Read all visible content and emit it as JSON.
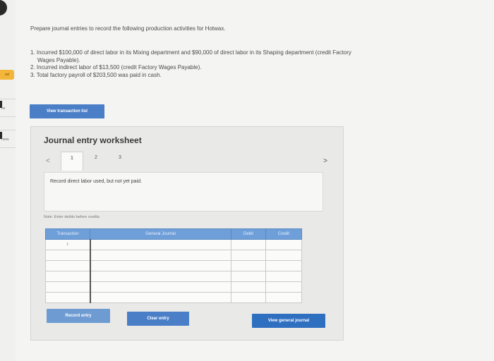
{
  "sidebar": {
    "badge_label": "ed",
    "items": [
      {
        "label": "ce"
      },
      {
        "label": "nces"
      }
    ]
  },
  "prompt": "Prepare journal entries to record the following production activities for Hotwax.",
  "steps": [
    {
      "line1": "1. Incurred $100,000 of direct labor in its Mixing department and $90,000 of direct labor in its Shaping department (credit Factory",
      "line2": "Wages Payable)."
    },
    {
      "line1": "2. Incurred indirect labor of $13,500 (credit Factory Wages Payable)."
    },
    {
      "line1": "3. Total factory payroll of $203,500 was paid in cash."
    }
  ],
  "buttons": {
    "view_transaction_list": "View transaction list",
    "record_entry": "Record entry",
    "clear_entry": "Clear entry",
    "view_general_journal": "View general journal"
  },
  "worksheet": {
    "title": "Journal entry worksheet",
    "tabs": [
      "1",
      "2",
      "3"
    ],
    "prev_symbol": "<",
    "next_symbol": ">",
    "description": "Record direct labor used, but not yet paid.",
    "note": "Note: Enter debits before credits."
  },
  "table": {
    "headers": [
      "Transaction",
      "General Journal",
      "Debit",
      "Credit"
    ],
    "rows": [
      [
        "1",
        "",
        "",
        ""
      ],
      [
        "",
        "",
        "",
        ""
      ],
      [
        "",
        "",
        "",
        ""
      ],
      [
        "",
        "",
        "",
        ""
      ],
      [
        "",
        "",
        "",
        ""
      ],
      [
        "",
        "",
        "",
        ""
      ]
    ]
  },
  "colors": {
    "accent": "#4a7fc8",
    "table_header": "#6f9fd8",
    "badge": "#f3b63a"
  }
}
